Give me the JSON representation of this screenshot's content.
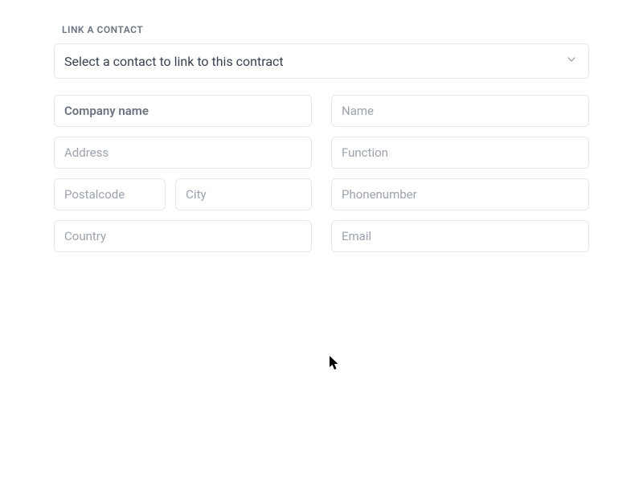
{
  "section": {
    "label": "LINK A CONTACT",
    "select_placeholder": "Select a contact to link to this contract"
  },
  "fields": {
    "company": "Company name",
    "address": "Address",
    "postalcode": "Postalcode",
    "city": "City",
    "country": "Country",
    "name": "Name",
    "function": "Function",
    "phone": "Phonenumber",
    "email": "Email"
  }
}
